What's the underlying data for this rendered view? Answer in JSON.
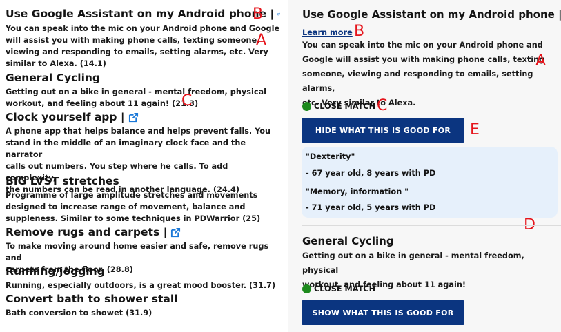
{
  "left": {
    "entries": [
      {
        "title": "Use Google Assistant on my Android phone |",
        "has_link": true,
        "desc": [
          "You can speak into the mic on your Android phone and Google",
          "will assist you with making phone calls, texting someone,",
          "viewing and responding to emails, setting alarms, etc. Very",
          "similar to Alexa. (14.1)"
        ]
      },
      {
        "title": "General Cycling",
        "has_link": false,
        "desc": [
          "Getting out on a bike in general - mental freedom, physical",
          "workout, and feeling about 11 again! (21.3)"
        ]
      },
      {
        "title": "Clock yourself app |",
        "has_link": true,
        "desc": [
          "A phone app that helps balance and helps prevent falls. You",
          "stand in the middle of an imaginary clock face and the narrator",
          "calls out numbers. You step where he calls. To add complexity,",
          "the numbers can be read in another language. (24.4)"
        ]
      },
      {
        "title": "BIG LVST stretches",
        "has_link": false,
        "desc": [
          "Programme of large amplitude stretches and movements",
          "designed to increase range of movement, balance and",
          "suppleness. Similar to some techniques in PDWarrior (25)"
        ]
      },
      {
        "title": "Remove rugs and carpets |",
        "has_link": true,
        "desc": [
          "To make moving around home easier and safe, remove rugs and",
          "carpets from the floor. (28.8)"
        ]
      },
      {
        "title": "Running/jogging",
        "has_link": false,
        "desc": [
          "Running, especially outdoors, is a great mood booster. (31.7)"
        ]
      },
      {
        "title": "Convert bath to shower stall",
        "has_link": false,
        "desc": [
          "Bath conversion to showet (31.9)"
        ]
      }
    ]
  },
  "right": {
    "card1": {
      "title": "Use Google Assistant on my Android phone |",
      "link": "Learn more",
      "desc": [
        "You can speak into the mic on your Android phone and",
        "Google will assist you with making phone calls, texting",
        "someone, viewing and responding to emails, setting alarms,",
        "etc. Very similar to Alexa."
      ],
      "match": "CLOSE MATCH",
      "button": "HIDE WHAT THIS IS GOOD FOR",
      "good_for": [
        {
          "label": "\"Dexterity\"",
          "who": "- 67 year old, 8 years with PD"
        },
        {
          "label": "\"Memory, information \"",
          "who": "- 71 year old, 5 years with PD"
        }
      ]
    },
    "card2": {
      "title": "General Cycling",
      "desc": [
        "Getting out on a bike in general - mental freedom, physical",
        "workout, and feeling about 11 again!"
      ],
      "match": "CLOSE MATCH",
      "button": "SHOW WHAT THIS IS GOOD FOR"
    }
  },
  "annotations": {
    "A": "A",
    "B": "B",
    "C": "C",
    "D": "D",
    "E": "E"
  },
  "colors": {
    "button": "#0b3580",
    "annotation": "#e5141b",
    "match_dot": "#1d8a1d",
    "panel": "#e6f0fb",
    "link_icon": "#1a78d8"
  },
  "icons": {
    "external_link": "external-link-icon"
  }
}
